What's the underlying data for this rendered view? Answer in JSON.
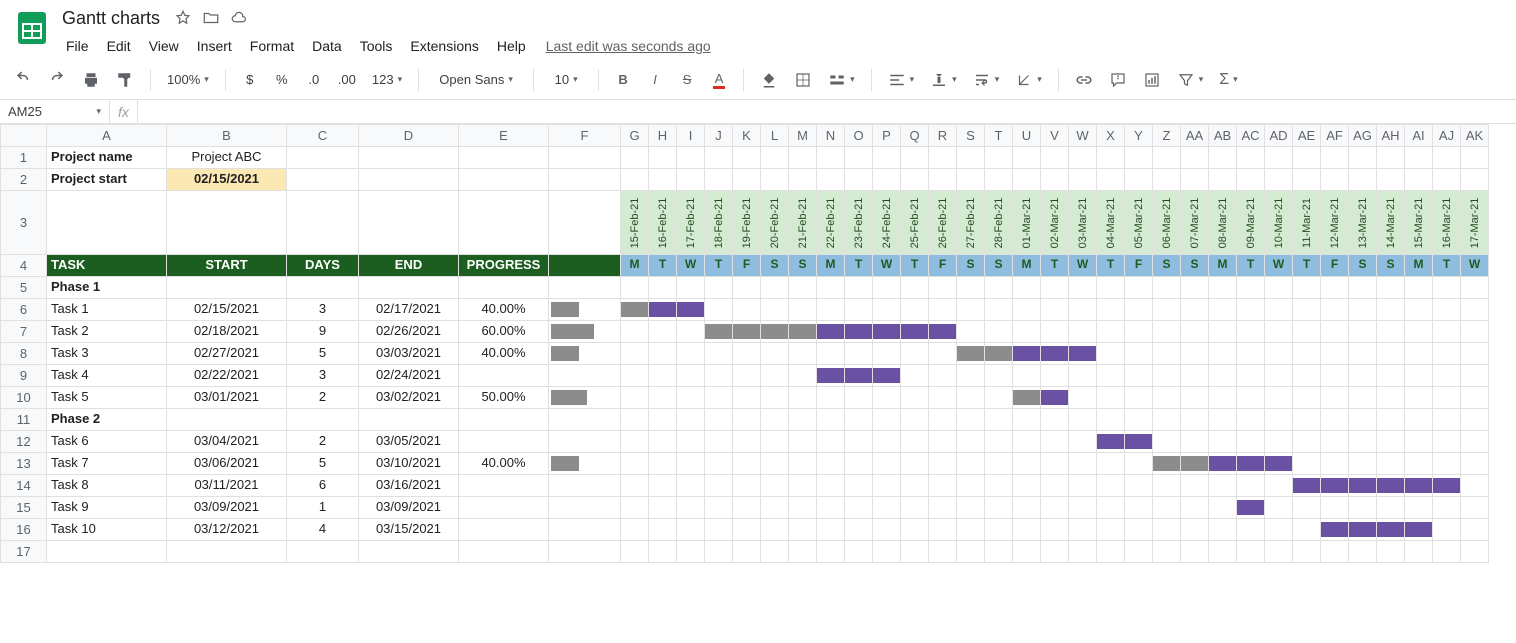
{
  "doc_title": "Gantt charts",
  "menus": [
    "File",
    "Edit",
    "View",
    "Insert",
    "Format",
    "Data",
    "Tools",
    "Extensions",
    "Help"
  ],
  "last_edit": "Last edit was seconds ago",
  "toolbar": {
    "zoom": "100%",
    "font": "Open Sans",
    "size": "10"
  },
  "namebox": "AM25",
  "cols_main": [
    "A",
    "B",
    "C",
    "D",
    "E",
    "F"
  ],
  "cols_days": [
    "G",
    "H",
    "I",
    "J",
    "K",
    "L",
    "M",
    "N",
    "O",
    "P",
    "Q",
    "R",
    "S",
    "T",
    "U",
    "V",
    "W",
    "X",
    "Y",
    "Z",
    "AA",
    "AB",
    "AC",
    "AD",
    "AE",
    "AF",
    "AG",
    "AH",
    "AI",
    "AJ",
    "AK"
  ],
  "project": {
    "name_label": "Project name",
    "name_value": "Project ABC",
    "start_label": "Project start",
    "start_value": "02/15/2021"
  },
  "headers": {
    "task": "TASK",
    "start": "START",
    "days": "DAYS",
    "end": "END",
    "progress": "PROGRESS"
  },
  "day_letters": [
    "M",
    "T",
    "W",
    "T",
    "F",
    "S",
    "S",
    "M",
    "T",
    "W",
    "T",
    "F",
    "S",
    "S",
    "M",
    "T",
    "W",
    "T",
    "F",
    "S",
    "S",
    "M",
    "T",
    "W",
    "T",
    "F",
    "S",
    "S",
    "M",
    "T",
    "W"
  ],
  "date_labels": [
    "15-Feb-21",
    "16-Feb-21",
    "17-Feb-21",
    "18-Feb-21",
    "19-Feb-21",
    "20-Feb-21",
    "21-Feb-21",
    "22-Feb-21",
    "23-Feb-21",
    "24-Feb-21",
    "25-Feb-21",
    "26-Feb-21",
    "27-Feb-21",
    "28-Feb-21",
    "01-Mar-21",
    "02-Mar-21",
    "03-Mar-21",
    "04-Mar-21",
    "05-Mar-21",
    "06-Mar-21",
    "07-Mar-21",
    "08-Mar-21",
    "09-Mar-21",
    "10-Mar-21",
    "11-Mar-21",
    "12-Mar-21",
    "13-Mar-21",
    "14-Mar-21",
    "15-Mar-21",
    "16-Mar-21",
    "17-Mar-21"
  ],
  "rows": [
    {
      "n": 5,
      "phase": "Phase 1"
    },
    {
      "n": 6,
      "task": "Task 1",
      "start": "02/15/2021",
      "days": "3",
      "end": "02/17/2021",
      "prog": "40.00%",
      "pbar": 40,
      "g_off": 0,
      "g_len": 3,
      "p_off": 1,
      "p_len": 2
    },
    {
      "n": 7,
      "task": "Task 2",
      "start": "02/18/2021",
      "days": "9",
      "end": "02/26/2021",
      "prog": "60.00%",
      "pbar": 60,
      "g_off": 3,
      "g_len": 9,
      "p_off": 7,
      "p_len": 5
    },
    {
      "n": 8,
      "task": "Task 3",
      "start": "02/27/2021",
      "days": "5",
      "end": "03/03/2021",
      "prog": "40.00%",
      "pbar": 40,
      "g_off": 12,
      "g_len": 5,
      "p_off": 14,
      "p_len": 3
    },
    {
      "n": 9,
      "task": "Task 4",
      "start": "02/22/2021",
      "days": "3",
      "end": "02/24/2021",
      "prog": "",
      "p_off": 7,
      "p_len": 3
    },
    {
      "n": 10,
      "task": "Task 5",
      "start": "03/01/2021",
      "days": "2",
      "end": "03/02/2021",
      "prog": "50.00%",
      "pbar": 50,
      "g_off": 14,
      "g_len": 2,
      "p_off": 15,
      "p_len": 1
    },
    {
      "n": 11,
      "phase": "Phase 2"
    },
    {
      "n": 12,
      "task": "Task 6",
      "start": "03/04/2021",
      "days": "2",
      "end": "03/05/2021",
      "prog": "",
      "p_off": 17,
      "p_len": 2
    },
    {
      "n": 13,
      "task": "Task 7",
      "start": "03/06/2021",
      "days": "5",
      "end": "03/10/2021",
      "prog": "40.00%",
      "pbar": 40,
      "g_off": 19,
      "g_len": 5,
      "p_off": 21,
      "p_len": 3
    },
    {
      "n": 14,
      "task": "Task 8",
      "start": "03/11/2021",
      "days": "6",
      "end": "03/16/2021",
      "prog": "",
      "p_off": 24,
      "p_len": 6
    },
    {
      "n": 15,
      "task": "Task 9",
      "start": "03/09/2021",
      "days": "1",
      "end": "03/09/2021",
      "prog": "",
      "p_off": 22,
      "p_len": 1
    },
    {
      "n": 16,
      "task": "Task 10",
      "start": "03/12/2021",
      "days": "4",
      "end": "03/15/2021",
      "prog": "",
      "p_off": 25,
      "p_len": 4
    },
    {
      "n": 17
    }
  ]
}
